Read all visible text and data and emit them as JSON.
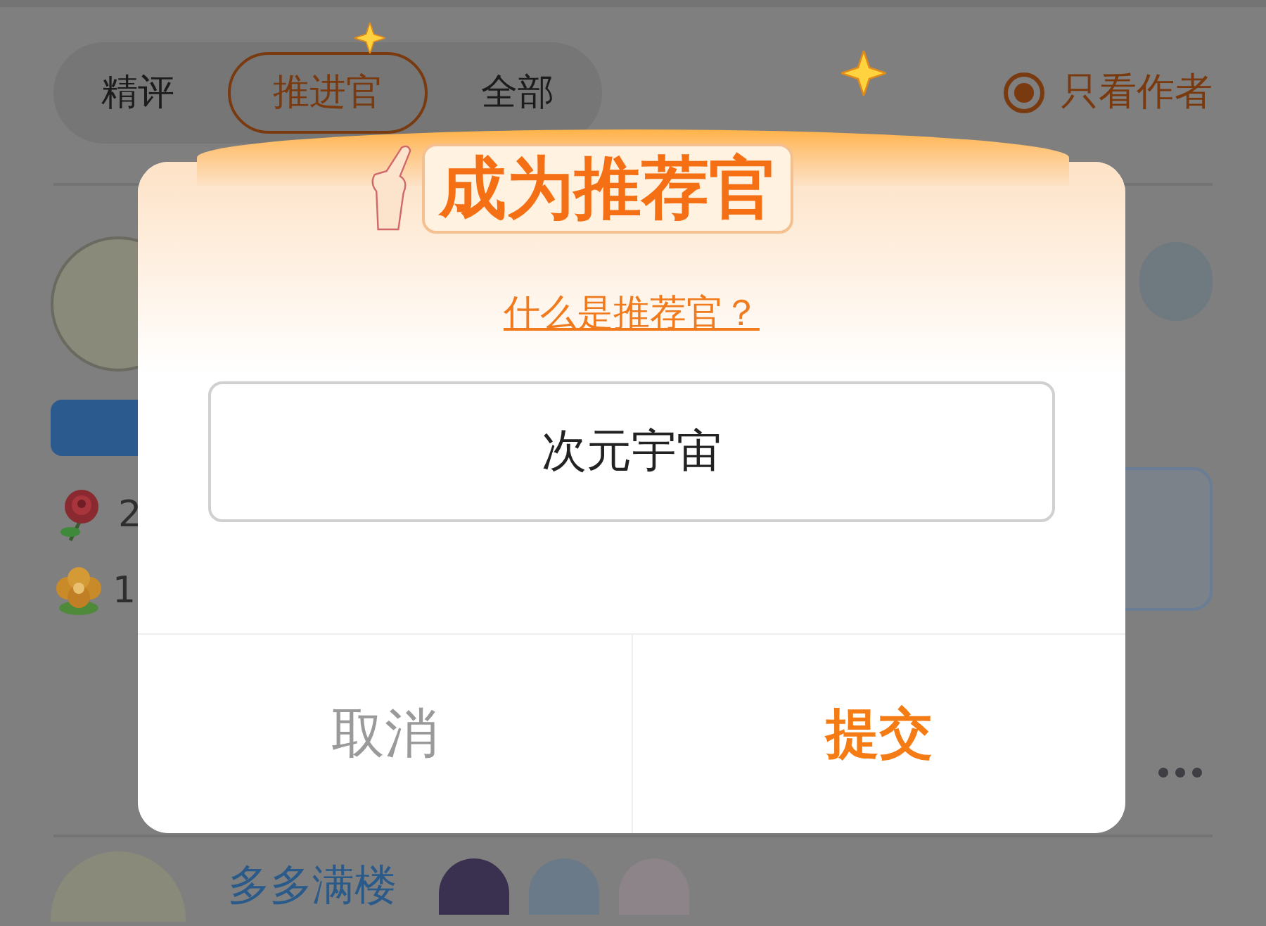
{
  "tabs": [
    {
      "label": "精评",
      "selected": false
    },
    {
      "label": "推进官",
      "selected": true
    },
    {
      "label": "全部",
      "selected": false
    }
  ],
  "author_filter": {
    "label": "只看作者",
    "selected": true
  },
  "post": {
    "stats": [
      {
        "kind": "rose",
        "count": "2"
      },
      {
        "kind": "flower",
        "count": "1"
      }
    ]
  },
  "next_post": {
    "author": "多多满楼"
  },
  "dialog": {
    "title": "成为推荐官",
    "help_link": "什么是推荐官？",
    "input": {
      "value": "次元宇宙"
    },
    "buttons": [
      {
        "label": "取消",
        "kind": "cancel"
      },
      {
        "label": "提交",
        "kind": "primary"
      }
    ]
  }
}
